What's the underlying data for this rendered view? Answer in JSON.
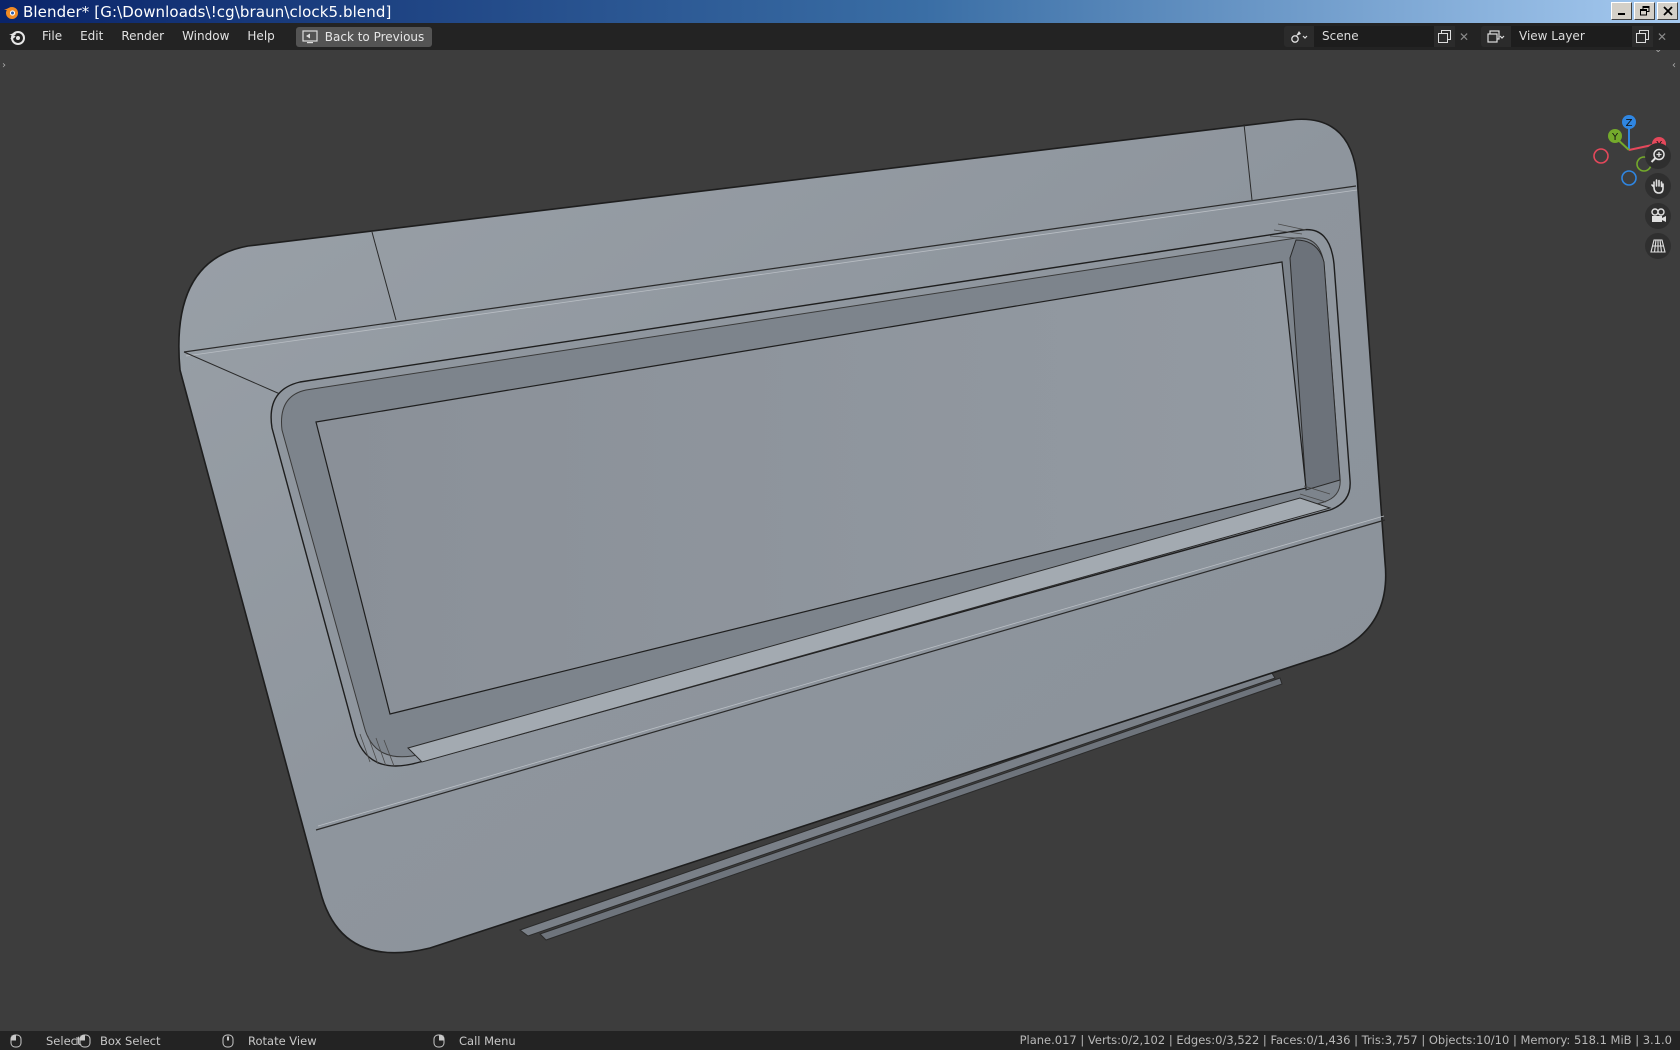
{
  "window": {
    "title": "Blender* [G:\\Downloads\\!cg\\braun\\clock5.blend]",
    "icon": "blender-app-icon",
    "controls": [
      "minimize-icon",
      "restore-icon",
      "close-icon"
    ]
  },
  "topbar": {
    "menus": [
      {
        "label": "File"
      },
      {
        "label": "Edit"
      },
      {
        "label": "Render"
      },
      {
        "label": "Window"
      },
      {
        "label": "Help"
      }
    ],
    "back_button": "Back to Previous",
    "scene": {
      "value": "Scene",
      "icon": "scene-icon"
    },
    "view_layer": {
      "value": "View Layer",
      "icon": "render-layers-icon"
    }
  },
  "viewport": {
    "gizmo_axes": {
      "x": "X",
      "y": "Y",
      "z": "Z"
    },
    "axis_colors": {
      "x": "#e5485b",
      "y": "#74aa2b",
      "z": "#2f86e2"
    },
    "tools": [
      "zoom-icon",
      "hand-pan-icon",
      "camera-icon",
      "perspective-grid-icon"
    ]
  },
  "statusbar": {
    "select": "Select",
    "box_select": "Box Select",
    "rotate": "Rotate View",
    "call_menu": "Call Menu",
    "stats": "Plane.017 | Verts:0/2,102 | Edges:0/3,522 | Faces:0/1,436 | Tris:3,757 | Objects:10/10 | Memory: 518.1 MiB | 3.1.0"
  }
}
